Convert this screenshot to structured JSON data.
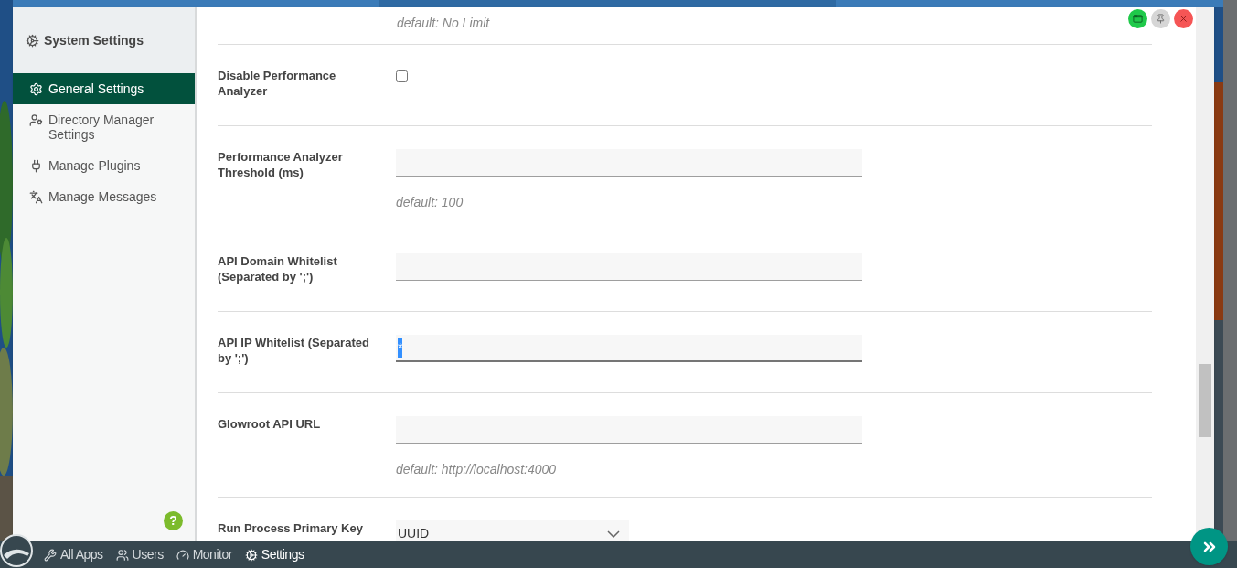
{
  "sidebar": {
    "title": "System Settings",
    "items": [
      {
        "label": "General Settings",
        "selected": true
      },
      {
        "label": "Directory Manager Settings",
        "selected": false
      },
      {
        "label": "Manage Plugins",
        "selected": false
      },
      {
        "label": "Manage Messages",
        "selected": false
      }
    ],
    "help": "?"
  },
  "top_hint": "default: No Limit",
  "settings": [
    {
      "kind": "checkbox",
      "label": "Disable Performance Analyzer",
      "checked": false
    },
    {
      "kind": "text",
      "label": "Performance Analyzer Threshold (ms)",
      "hint": "default: 100",
      "focused": false
    },
    {
      "kind": "text",
      "label": "API Domain Whitelist (Separated by ';')",
      "focused": false
    },
    {
      "kind": "text",
      "label": "API IP Whitelist (Separated by ';')",
      "value": "*",
      "focused": true
    },
    {
      "kind": "text",
      "label": "Glowroot API URL",
      "hint": "default: http://localhost:4000",
      "focused": false
    },
    {
      "kind": "select",
      "label": "Run Process Primary Key",
      "value": "UUID"
    }
  ],
  "taskbar": [
    {
      "label": "All Apps",
      "selected": false
    },
    {
      "label": "Users",
      "selected": false
    },
    {
      "label": "Monitor",
      "selected": false
    },
    {
      "label": "Settings",
      "selected": true
    }
  ]
}
